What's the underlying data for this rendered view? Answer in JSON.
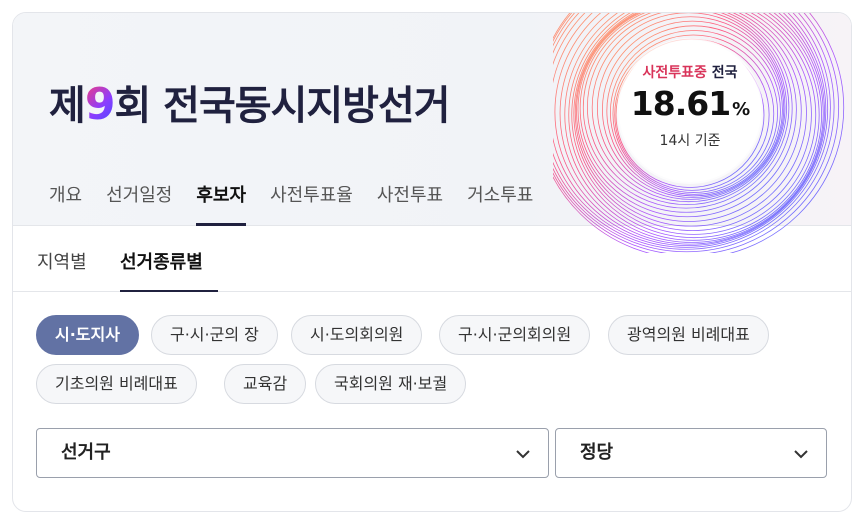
{
  "hero": {
    "title_prefix": "제",
    "title_number": "9",
    "title_suffix": "회 전국동시지방선거",
    "badge": {
      "label_accent": "사전투표중",
      "label_dark": "전국",
      "value": "18.61",
      "unit": "%",
      "sub": "14시 기준"
    }
  },
  "main_tabs": [
    {
      "label": "개요"
    },
    {
      "label": "선거일정"
    },
    {
      "label": "후보자",
      "active": true
    },
    {
      "label": "사전투표율"
    },
    {
      "label": "사전투표"
    },
    {
      "label": "거소투표"
    }
  ],
  "sub_tabs": [
    {
      "label": "지역별"
    },
    {
      "label": "선거종류별",
      "active": true
    }
  ],
  "chips": [
    {
      "label": "시·도지사",
      "active": true
    },
    {
      "label": "구·시·군의 장"
    },
    {
      "label": "시·도의회의원"
    },
    {
      "label": "구·시·군의회의원"
    },
    {
      "label": "광역의원 비례대표"
    },
    {
      "label": "기초의원 비례대표"
    },
    {
      "label": "교육감"
    },
    {
      "label": "국회의원 재·보궐"
    }
  ],
  "filters": {
    "district_label": "선거구",
    "party_label": "정당"
  },
  "colors": {
    "accent": "#6272a4",
    "title": "#20213f",
    "badge_accent": "#d9345a"
  }
}
